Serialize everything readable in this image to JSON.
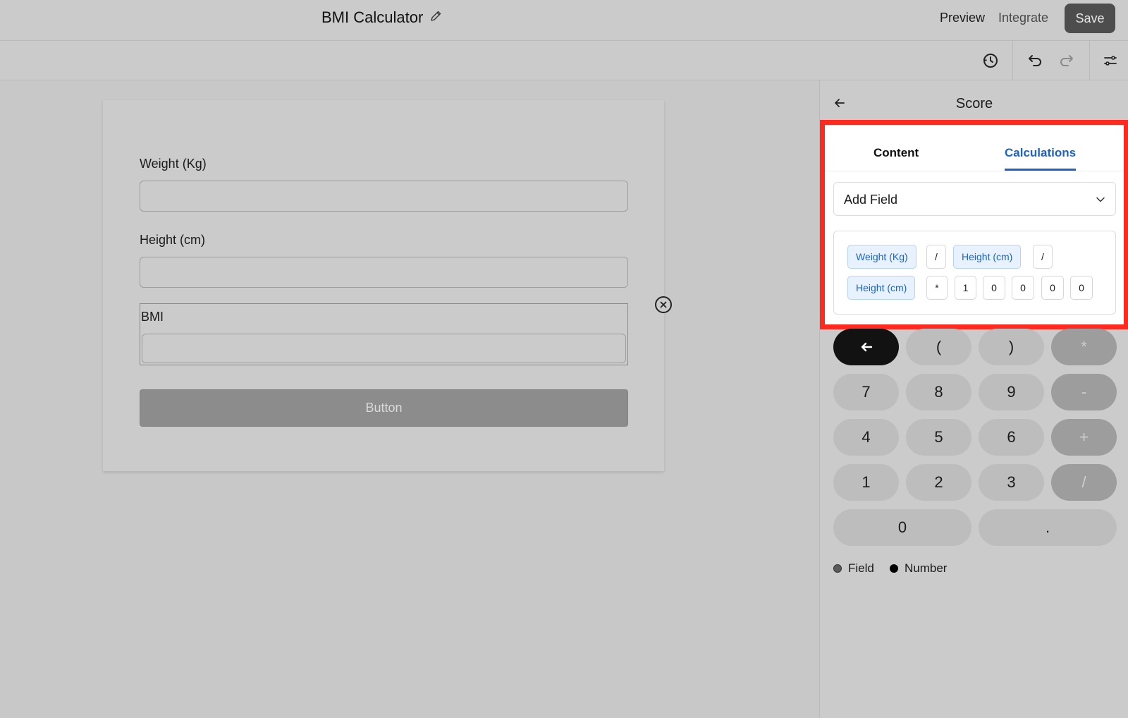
{
  "header": {
    "title": "BMI Calculator",
    "preview_label": "Preview",
    "integrate_label": "Integrate",
    "save_label": "Save"
  },
  "toolbar": {
    "icons": [
      "history-icon",
      "undo-icon",
      "redo-icon",
      "settings-sliders-icon"
    ]
  },
  "form": {
    "fields": [
      {
        "label": "Weight (Kg)",
        "value": ""
      },
      {
        "label": "Height (cm)",
        "value": ""
      },
      {
        "label": "BMI",
        "value": ""
      }
    ],
    "button_label": "Button"
  },
  "panel": {
    "title": "Score",
    "tabs": [
      {
        "label": "Content",
        "active": false
      },
      {
        "label": "Calculations",
        "active": true
      }
    ],
    "add_field_label": "Add Field",
    "expression": {
      "row1": [
        {
          "type": "field",
          "text": "Weight (Kg)"
        },
        {
          "type": "op",
          "text": "/"
        },
        {
          "type": "field",
          "text": "Height (cm)"
        },
        {
          "type": "op",
          "text": "/"
        }
      ],
      "row2": [
        {
          "type": "field",
          "text": "Height (cm)"
        },
        {
          "type": "op",
          "text": "*"
        },
        {
          "type": "num",
          "text": "1"
        },
        {
          "type": "num",
          "text": "0"
        },
        {
          "type": "num",
          "text": "0"
        },
        {
          "type": "num",
          "text": "0"
        },
        {
          "type": "num",
          "text": "0"
        }
      ]
    },
    "keypad": {
      "row1": [
        "(",
        ")",
        "*"
      ],
      "row2": [
        "7",
        "8",
        "9",
        "-"
      ],
      "row3": [
        "4",
        "5",
        "6",
        "+"
      ],
      "row4": [
        "1",
        "2",
        "3",
        "/"
      ],
      "row5": [
        "0",
        "."
      ]
    },
    "legend": [
      {
        "label": "Field",
        "color": "#5a5a5a"
      },
      {
        "label": "Number",
        "color": "#000000"
      }
    ]
  },
  "colors": {
    "accent": "#1e63c4",
    "highlight_border": "#ff2a1f",
    "save_bg": "#4d4d4d"
  }
}
